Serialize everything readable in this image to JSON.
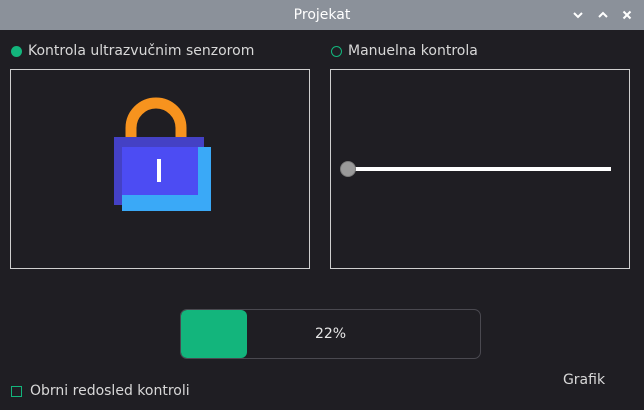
{
  "window": {
    "title": "Projekat",
    "buttons": [
      {
        "name": "minimize",
        "icon": "chevron-down-icon"
      },
      {
        "name": "maximize",
        "icon": "chevron-up-icon"
      },
      {
        "name": "close",
        "icon": "close-icon"
      }
    ]
  },
  "modes": [
    {
      "label": "Kontrola ultrazvučnim senzorom",
      "selected": true
    },
    {
      "label": "Manuelna kontrola",
      "selected": false
    }
  ],
  "sensor_panel": {
    "icon": "lock-icon",
    "colors": {
      "shackle": "#f7931e",
      "body_back": "#4441c5",
      "body_front": "#3aa9f7",
      "body_main": "#4c4cf3"
    }
  },
  "manual_panel": {
    "slider_value": 0
  },
  "progress": {
    "value": 22,
    "label": "22%"
  },
  "checkbox": {
    "label": "Obrni redosled kontroli",
    "checked": false
  },
  "graph_button": {
    "label": "Grafik"
  },
  "colors": {
    "accent": "#13b57c",
    "background": "#1f1e23",
    "titlebar": "#8b919a"
  }
}
